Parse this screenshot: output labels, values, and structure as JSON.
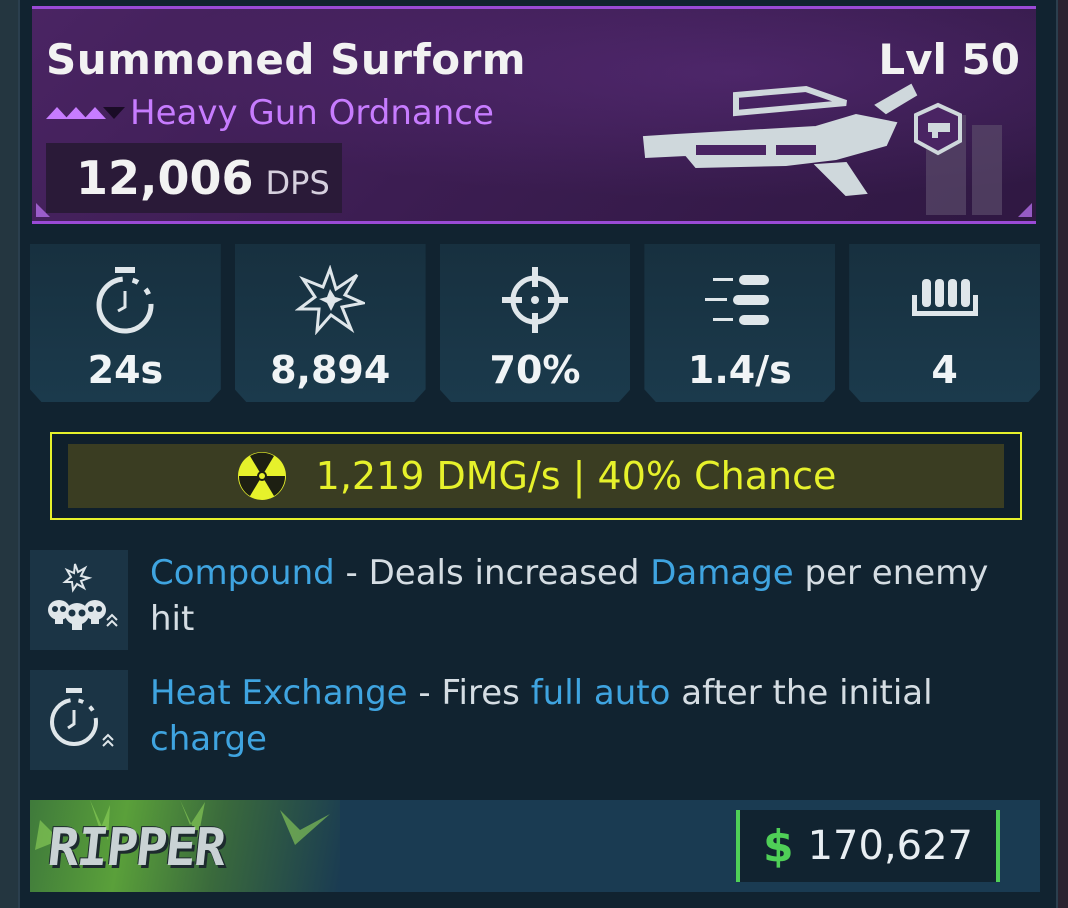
{
  "weapon": {
    "name": "Summoned Surform",
    "level": "Lvl 50",
    "type": "Heavy Gun Ordnance",
    "dps_value": "12,006",
    "dps_unit": "DPS",
    "rarity_color": "#c77cff"
  },
  "stats": [
    {
      "icon": "stopwatch-icon",
      "value": "24s"
    },
    {
      "icon": "damage-burst-icon",
      "value": "8,894"
    },
    {
      "icon": "crosshair-icon",
      "value": "70%"
    },
    {
      "icon": "fire-rate-bullets-icon",
      "value": "1.4/s"
    },
    {
      "icon": "magazine-icon",
      "value": "4"
    }
  ],
  "element": {
    "icon": "radiation-icon",
    "text": "1,219 DMG/s | 40% Chance",
    "color": "#e6f12b"
  },
  "perks": [
    {
      "icon": "skulls-icon",
      "parts": [
        {
          "text": "Compound",
          "kw": true
        },
        {
          "text": " - Deals increased ",
          "kw": false
        },
        {
          "text": "Damage",
          "kw": true
        },
        {
          "text": " per enemy hit",
          "kw": false
        }
      ]
    },
    {
      "icon": "stopwatch-upgrade-icon",
      "parts": [
        {
          "text": "Heat Exchange",
          "kw": true
        },
        {
          "text": " - Fires ",
          "kw": false
        },
        {
          "text": "full auto",
          "kw": true
        },
        {
          "text": " after the initial ",
          "kw": false
        },
        {
          "text": "charge",
          "kw": true
        }
      ]
    }
  ],
  "footer": {
    "manufacturer": "RIPPER",
    "price_icon": "$",
    "price": "170,627",
    "price_color": "#4fcf57"
  }
}
